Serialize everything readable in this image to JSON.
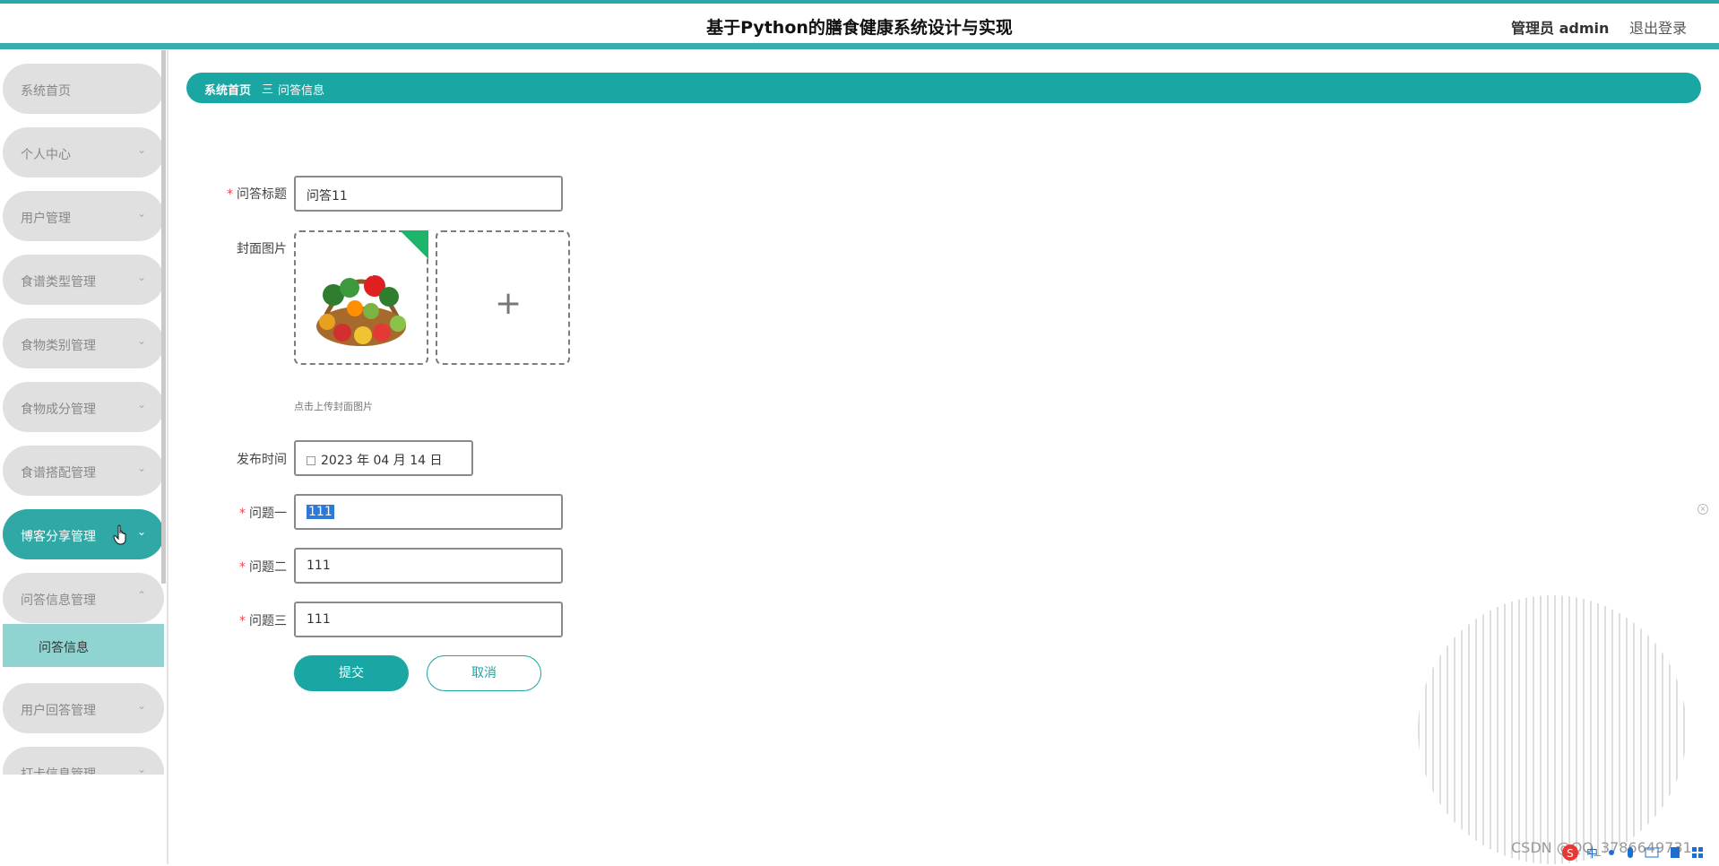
{
  "header": {
    "app_title": "基于Python的膳食健康系统设计与实现",
    "user_label": "管理员 admin",
    "logout_label": "退出登录"
  },
  "sidebar": {
    "items": [
      {
        "label": "系统首页"
      },
      {
        "label": "个人中心"
      },
      {
        "label": "用户管理"
      },
      {
        "label": "食谱类型管理"
      },
      {
        "label": "食物类别管理"
      },
      {
        "label": "食物成分管理"
      },
      {
        "label": "食谱搭配管理"
      },
      {
        "label": "博客分享管理"
      },
      {
        "label": "问答信息管理"
      },
      {
        "label": "用户回答管理"
      },
      {
        "label": "打卡信息管理"
      }
    ],
    "sub_item": "问答信息",
    "chevron_down": "⌄",
    "chevron_up": "⌃"
  },
  "breadcrumb": {
    "home": "系统首页",
    "separator": "三",
    "current": "问答信息"
  },
  "form": {
    "title_label": "问答标题",
    "title_value": "问答11",
    "cover_label": "封面图片",
    "cover_tip": "点击上传封面图片",
    "plus": "+",
    "publish_label": "发布时间",
    "publish_value": "2023 年 04 月 14 日",
    "q1_label": "问题一",
    "q1_value": "111",
    "q2_label": "问题二",
    "q2_value": "111",
    "q3_label": "问题三",
    "q3_value": "111",
    "required_mark": "*"
  },
  "buttons": {
    "submit": "提交",
    "cancel": "取消"
  },
  "watermark": "CSDN @QQ_3786649731",
  "colors": {
    "accent": "#1aa6a3",
    "active_menu": "#2fa8a6",
    "submenu_bg": "#8fd4d1",
    "menu_bg": "#e0e0e0",
    "required": "#e24c4c",
    "upload_success": "#1cb56a"
  }
}
